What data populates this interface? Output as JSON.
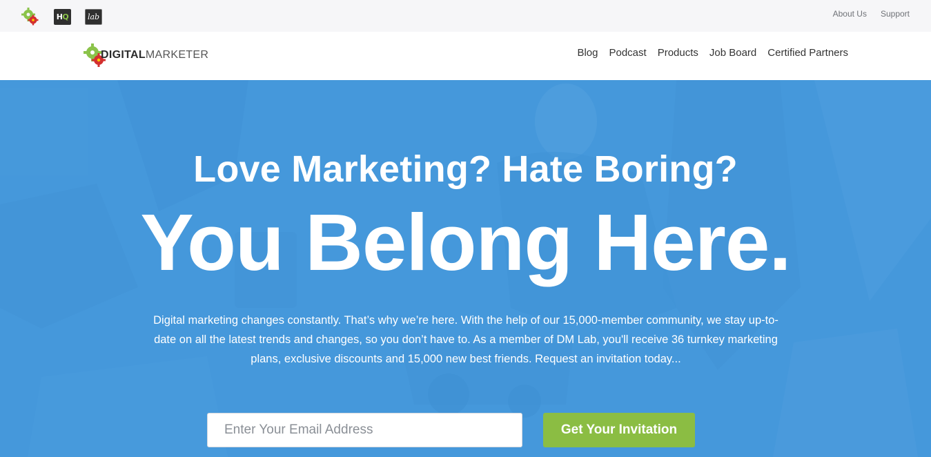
{
  "utility_bar": {
    "brand_icons": [
      {
        "name": "digitalmarketer-gears-icon"
      },
      {
        "name": "hq-icon",
        "text_h": "H",
        "text_q": "Q"
      },
      {
        "name": "lab-icon",
        "text": "lab"
      }
    ],
    "links": [
      "About Us",
      "Support"
    ]
  },
  "main_nav": {
    "logo": {
      "bold": "DIGITAL",
      "light": "MARKETER"
    },
    "links": [
      "Blog",
      "Podcast",
      "Products",
      "Job Board",
      "Certified Partners"
    ]
  },
  "hero": {
    "headline_1": "Love Marketing? Hate Boring?",
    "headline_2": "You Belong Here.",
    "copy": "Digital marketing changes constantly. That’s why we’re here. With the help of our 15,000-member community, we stay up-to-date on all the latest trends and changes, so you don’t have to. As a member of DM Lab, you'll receive 36 turnkey marketing plans, exclusive discounts and 15,000 new best friends. Request an invitation today...",
    "email_placeholder": "Enter Your Email Address",
    "email_value": "",
    "cta_label": "Get Your Invitation"
  },
  "colors": {
    "hero_blue": "#4a9ede",
    "cta_green": "#8bbd43",
    "util_bar_bg": "#f6f6f8",
    "gear_green": "#8bc34a",
    "gear_red": "#d32f2f"
  }
}
